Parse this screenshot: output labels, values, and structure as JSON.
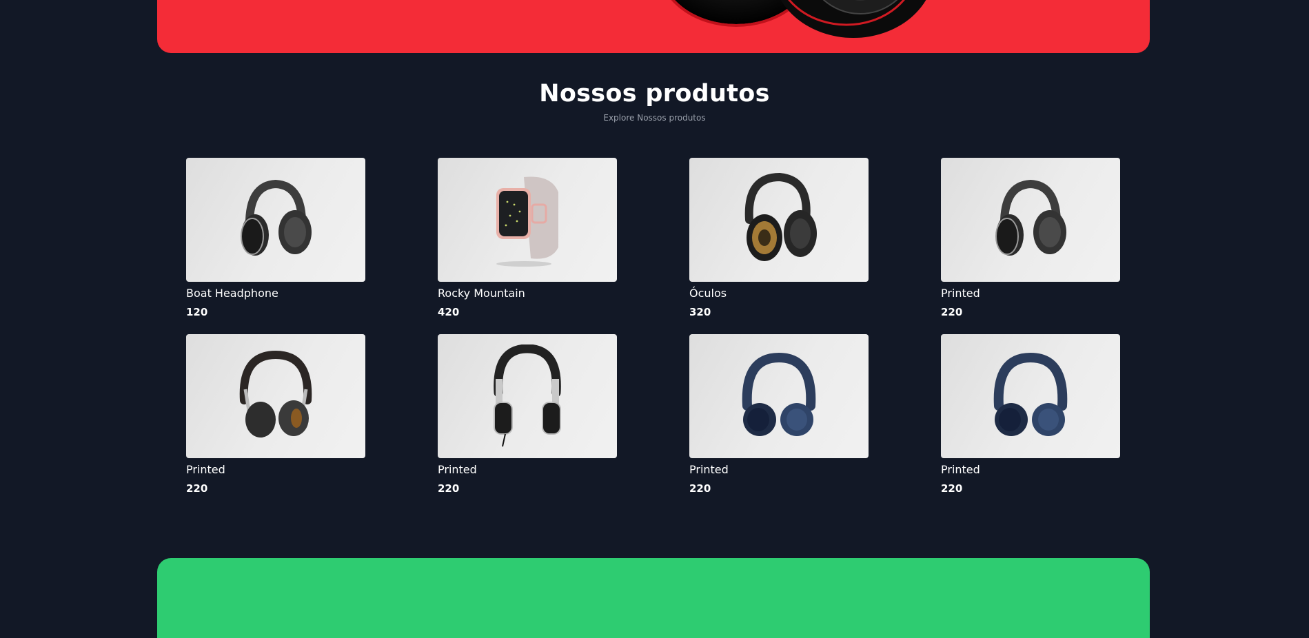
{
  "colors": {
    "background": "#121826",
    "hero_banner": "#f42c37",
    "footer_banner": "#2ecc71",
    "card_image_bg": "#e9e9e9"
  },
  "section": {
    "title": "Nossos produtos",
    "subtitle": "Explore Nossos produtos"
  },
  "products": [
    {
      "name": "Boat Headphone",
      "price": "120",
      "image": "headphone-gray-icon"
    },
    {
      "name": "Rocky Mountain",
      "price": "420",
      "image": "smartwatch-pink-icon"
    },
    {
      "name": "Óculos",
      "price": "320",
      "image": "headphone-black-gold-icon"
    },
    {
      "name": "Printed",
      "price": "220",
      "image": "headphone-gray-icon"
    },
    {
      "name": "Printed",
      "price": "220",
      "image": "headphone-black-silver-icon"
    },
    {
      "name": "Printed",
      "price": "220",
      "image": "headphone-dj-silver-icon"
    },
    {
      "name": "Printed",
      "price": "220",
      "image": "headphone-navy-icon"
    },
    {
      "name": "Printed",
      "price": "220",
      "image": "headphone-navy-icon"
    }
  ]
}
